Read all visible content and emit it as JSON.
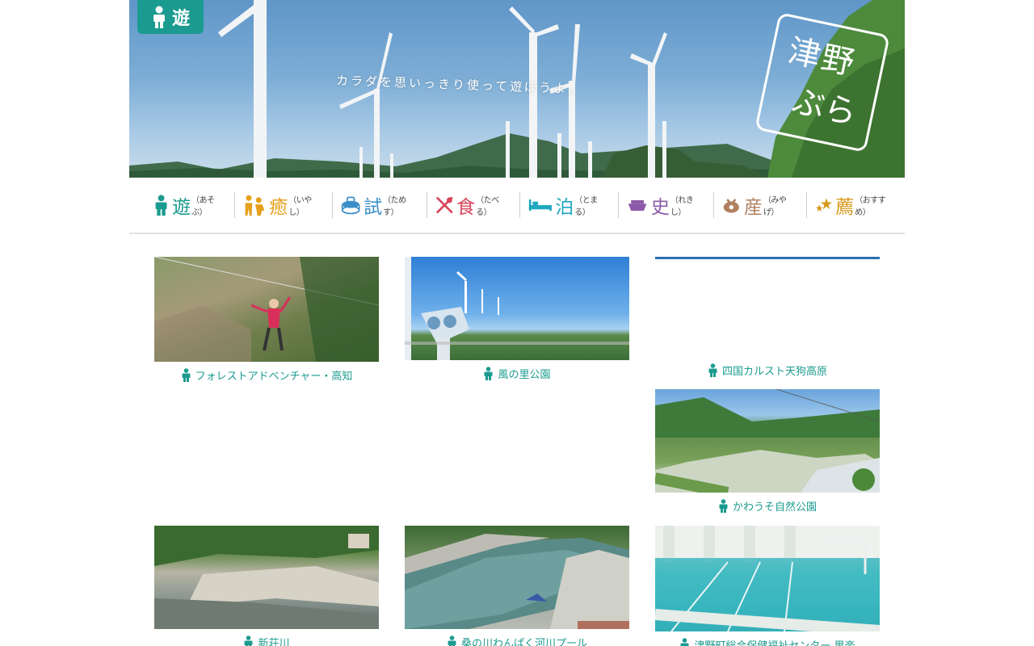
{
  "hero": {
    "badge_label": "遊",
    "catchphrase": "カラダを思いっきり使って遊ぼうよ。",
    "logo_line1": "津野",
    "logo_line2": "ぶら"
  },
  "categories": [
    {
      "kanji": "遊",
      "reading": "（あそぶ）",
      "color": "#1b9b8f",
      "icon": "play-person-icon"
    },
    {
      "kanji": "癒",
      "reading": "（いやし）",
      "color": "#e6a01a",
      "icon": "relax-people-icon"
    },
    {
      "kanji": "試",
      "reading": "（ためす）",
      "color": "#3b8fc9",
      "icon": "experience-pot-icon"
    },
    {
      "kanji": "食",
      "reading": "（たべる）",
      "color": "#d9445a",
      "icon": "fork-spoon-icon"
    },
    {
      "kanji": "泊",
      "reading": "（とまる）",
      "color": "#20a8c0",
      "icon": "bed-icon"
    },
    {
      "kanji": "史",
      "reading": "（れきし）",
      "color": "#8c5aa8",
      "icon": "history-roof-icon"
    },
    {
      "kanji": "産",
      "reading": "（みやげ）",
      "color": "#b08060",
      "icon": "souvenir-icon"
    },
    {
      "kanji": "薦",
      "reading": "（おすすめ）",
      "color": "#d69a1e",
      "icon": "recommend-stars-icon"
    }
  ],
  "items": [
    {
      "title": "フォレストアドベンチャー・高知"
    },
    {
      "title": "風の里公園"
    },
    {
      "title": "四国カルスト天狗高原"
    },
    {
      "title": "かわうそ自然公園"
    },
    {
      "title": "新荘川"
    },
    {
      "title": "桑の川わんぱく河川プール"
    },
    {
      "title": "津野町総合保健福祉センター 里楽"
    }
  ]
}
